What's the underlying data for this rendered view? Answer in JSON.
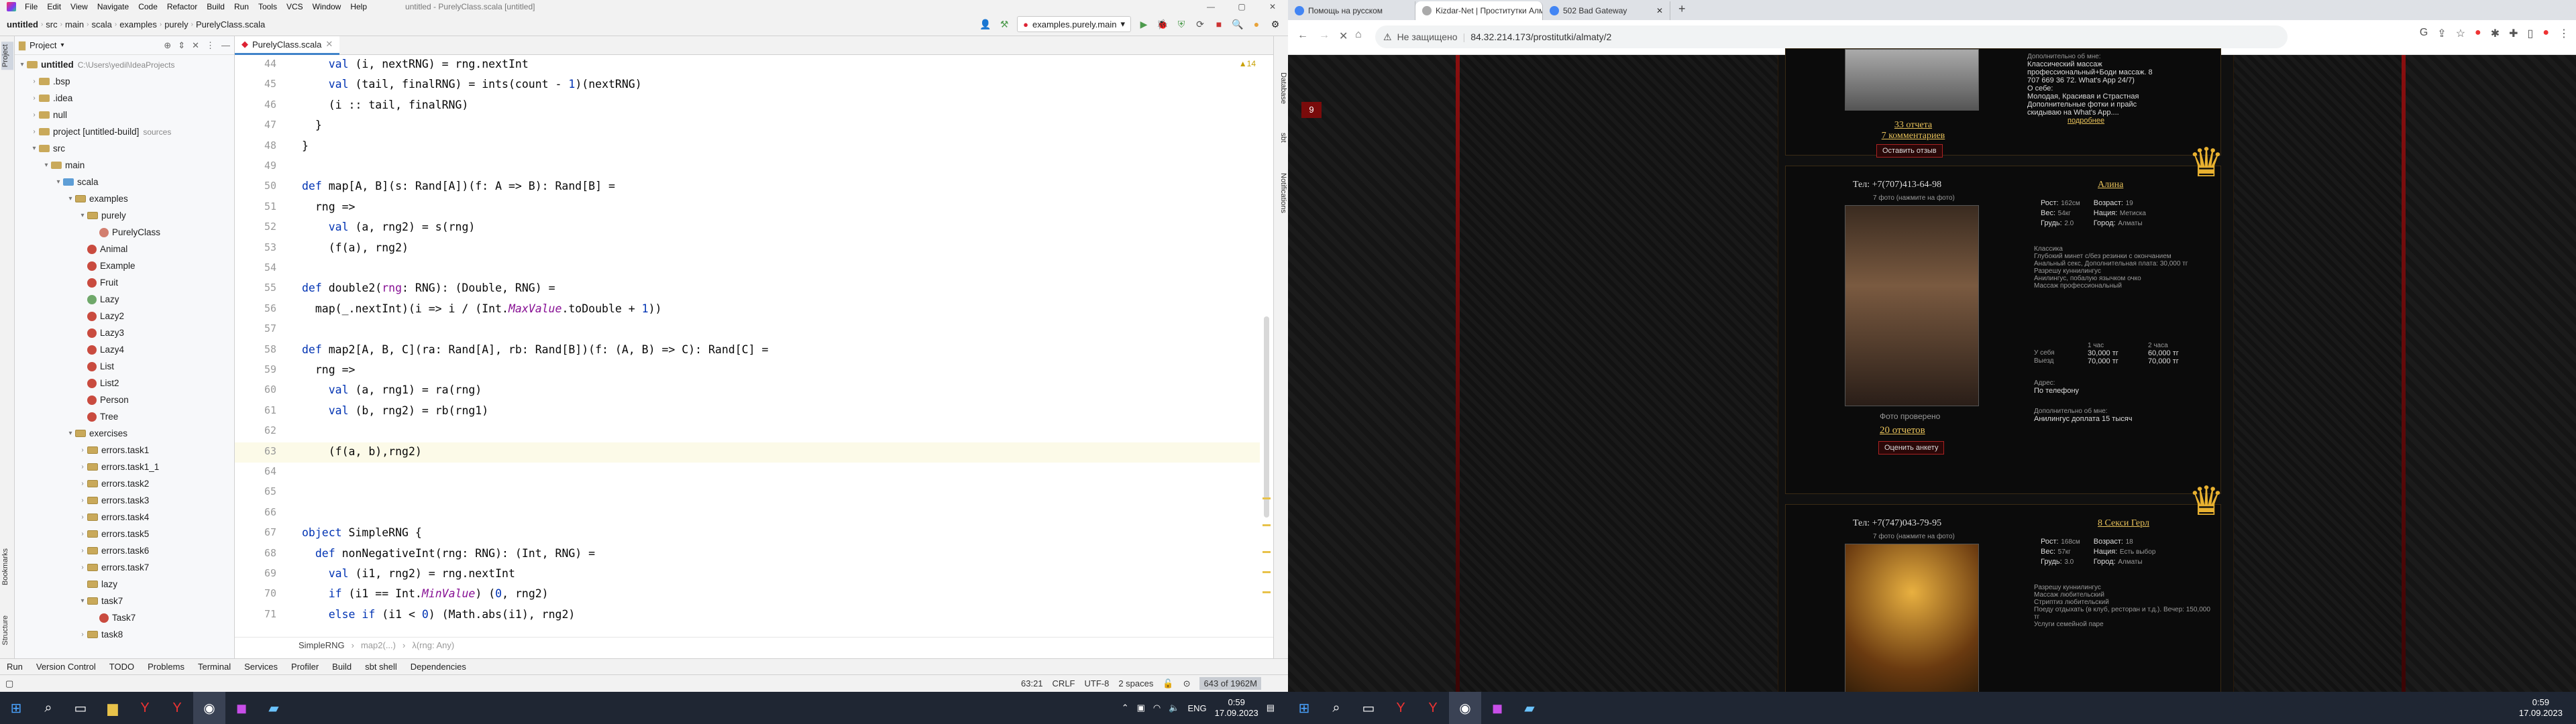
{
  "ide": {
    "menu": [
      "File",
      "Edit",
      "View",
      "Navigate",
      "Code",
      "Refactor",
      "Build",
      "Run",
      "Tools",
      "VCS",
      "Window",
      "Help"
    ],
    "window_title": "untitled - PurelyClass.scala [untitled]",
    "breadcrumbs": [
      "untitled",
      "src",
      "main",
      "scala",
      "examples",
      "purely",
      "PurelyClass.scala"
    ],
    "run_config": "examples.purely.main",
    "project_label": "Project",
    "tree": [
      {
        "indent": 0,
        "arrow": "▾",
        "icon": "f-folder",
        "label": "untitled",
        "extra": "C:\\Users\\yedil\\IdeaProjects",
        "bold": true
      },
      {
        "indent": 1,
        "arrow": "›",
        "icon": "f-folder",
        "label": ".bsp"
      },
      {
        "indent": 1,
        "arrow": "›",
        "icon": "f-folder",
        "label": ".idea"
      },
      {
        "indent": 1,
        "arrow": "›",
        "icon": "f-folder",
        "label": "null"
      },
      {
        "indent": 1,
        "arrow": "›",
        "icon": "f-folder",
        "label": "project [untitled-build]",
        "extra": "sources"
      },
      {
        "indent": 1,
        "arrow": "▾",
        "icon": "f-folder",
        "label": "src"
      },
      {
        "indent": 2,
        "arrow": "▾",
        "icon": "f-folder",
        "label": "main"
      },
      {
        "indent": 3,
        "arrow": "▾",
        "icon": "f-src",
        "label": "scala"
      },
      {
        "indent": 4,
        "arrow": "▾",
        "icon": "f-pkg",
        "label": "examples"
      },
      {
        "indent": 5,
        "arrow": "▾",
        "icon": "f-pkg",
        "label": "purely"
      },
      {
        "indent": 6,
        "arrow": "",
        "icon": "f-obj",
        "label": "PurelyClass"
      },
      {
        "indent": 5,
        "arrow": "",
        "icon": "f-class",
        "label": "Animal"
      },
      {
        "indent": 5,
        "arrow": "",
        "icon": "f-class",
        "label": "Example"
      },
      {
        "indent": 5,
        "arrow": "",
        "icon": "f-class",
        "label": "Fruit"
      },
      {
        "indent": 5,
        "arrow": "",
        "icon": "f-trait",
        "label": "Lazy"
      },
      {
        "indent": 5,
        "arrow": "",
        "icon": "f-class",
        "label": "Lazy2"
      },
      {
        "indent": 5,
        "arrow": "",
        "icon": "f-class",
        "label": "Lazy3"
      },
      {
        "indent": 5,
        "arrow": "",
        "icon": "f-class",
        "label": "Lazy4"
      },
      {
        "indent": 5,
        "arrow": "",
        "icon": "f-class",
        "label": "List"
      },
      {
        "indent": 5,
        "arrow": "",
        "icon": "f-class",
        "label": "List2"
      },
      {
        "indent": 5,
        "arrow": "",
        "icon": "f-class",
        "label": "Person"
      },
      {
        "indent": 5,
        "arrow": "",
        "icon": "f-class",
        "label": "Tree"
      },
      {
        "indent": 4,
        "arrow": "▾",
        "icon": "f-pkg",
        "label": "exercises"
      },
      {
        "indent": 5,
        "arrow": "›",
        "icon": "f-pkg",
        "label": "errors.task1"
      },
      {
        "indent": 5,
        "arrow": "›",
        "icon": "f-pkg",
        "label": "errors.task1_1"
      },
      {
        "indent": 5,
        "arrow": "›",
        "icon": "f-pkg",
        "label": "errors.task2"
      },
      {
        "indent": 5,
        "arrow": "›",
        "icon": "f-pkg",
        "label": "errors.task3"
      },
      {
        "indent": 5,
        "arrow": "›",
        "icon": "f-pkg",
        "label": "errors.task4"
      },
      {
        "indent": 5,
        "arrow": "›",
        "icon": "f-pkg",
        "label": "errors.task5"
      },
      {
        "indent": 5,
        "arrow": "›",
        "icon": "f-pkg",
        "label": "errors.task6"
      },
      {
        "indent": 5,
        "arrow": "›",
        "icon": "f-pkg",
        "label": "errors.task7"
      },
      {
        "indent": 5,
        "arrow": "",
        "icon": "f-pkg",
        "label": "lazy"
      },
      {
        "indent": 5,
        "arrow": "▾",
        "icon": "f-pkg",
        "label": "task7"
      },
      {
        "indent": 6,
        "arrow": "",
        "icon": "f-class",
        "label": "Task7"
      },
      {
        "indent": 5,
        "arrow": "›",
        "icon": "f-pkg",
        "label": "task8"
      }
    ],
    "editor_tab": "PurelyClass.scala",
    "warnings_count": "▲14",
    "code_lines": [
      {
        "n": "44",
        "html": "    <span class='kw'>val</span> (i, nextRNG) = rng.nextInt"
      },
      {
        "n": "45",
        "html": "    <span class='kw'>val</span> (tail, finalRNG) = ints(count - <span class='kw'>1</span>)(nextRNG)"
      },
      {
        "n": "46",
        "html": "    (i :: tail, finalRNG)"
      },
      {
        "n": "47",
        "html": "  }"
      },
      {
        "n": "48",
        "html": "}"
      },
      {
        "n": "49",
        "html": ""
      },
      {
        "n": "50",
        "html": "<span class='kw'>def</span> map[A, B](s: Rand[A])(f: A => B): Rand[B] ="
      },
      {
        "n": "51",
        "html": "  rng =>"
      },
      {
        "n": "52",
        "html": "    <span class='kw'>val</span> (a, rng2) = s(rng)"
      },
      {
        "n": "53",
        "html": "    (f(a), rng2)"
      },
      {
        "n": "54",
        "html": ""
      },
      {
        "n": "55",
        "html": "<span class='kw'>def</span> double2(<span class='pm'>rng</span>: RNG): (Double, RNG) ="
      },
      {
        "n": "56",
        "html": "  map(_.nextInt)(i => i / (Int.<span class='it'>MaxValue</span>.toDouble + <span class='kw'>1</span>))"
      },
      {
        "n": "57",
        "html": ""
      },
      {
        "n": "58",
        "html": "<span class='kw'>def</span> map2[A, B, C](ra: Rand[A], rb: Rand[B])(f: (A, B) => C): Rand[C] ="
      },
      {
        "n": "59",
        "html": "  rng =>"
      },
      {
        "n": "60",
        "html": "    <span class='kw'>val</span> (a, rng1) = ra(rng)"
      },
      {
        "n": "61",
        "html": "    <span class='kw'>val</span> (b, rng2) = rb(rng1)"
      },
      {
        "n": "62",
        "html": ""
      },
      {
        "n": "63",
        "html": "    (f(a, b),rng2)"
      },
      {
        "n": "64",
        "html": ""
      },
      {
        "n": "65",
        "html": ""
      },
      {
        "n": "66",
        "html": ""
      },
      {
        "n": "67",
        "html": "<span class='kw'>object</span> SimpleRNG {"
      },
      {
        "n": "68",
        "html": "  <span class='kw'>def</span> nonNegativeInt(rng: RNG): (Int, RNG) ="
      },
      {
        "n": "69",
        "html": "    <span class='kw'>val</span> (i1, rng2) = rng.nextInt"
      },
      {
        "n": "70",
        "html": "    <span class='kw'>if</span> (i1 == Int.<span class='it'>MinValue</span>) (<span class='kw'>0</span>, rng2)"
      },
      {
        "n": "71",
        "html": "    <span class='kw'>else if</span> (i1 < <span class='kw'>0</span>) (Math.abs(i1), rng2)"
      }
    ],
    "editor_breadcrumb": [
      "SimpleRNG",
      "map2(...)",
      "λ(rng: Any)"
    ],
    "tool_windows": [
      "Run",
      "Version Control",
      "TODO",
      "Problems",
      "Terminal",
      "Services",
      "Profiler",
      "Build",
      "sbt shell",
      "Dependencies"
    ],
    "right_tabs": [
      "Database",
      "sbt",
      "Notifications"
    ],
    "left_tabs": [
      "Project",
      "Bookmarks",
      "Structure"
    ],
    "status": {
      "position": "63:21",
      "line_sep": "CRLF",
      "encoding": "UTF-8",
      "indent": "2 spaces",
      "memory": "643 of 1962M"
    }
  },
  "taskbar": {
    "time": "0:59",
    "date": "17.09.2023",
    "lang": "ENG"
  },
  "browser": {
    "tabs": [
      {
        "title": "Помощь на русском",
        "color": "#4285f4"
      },
      {
        "title": "Kizdar-Net | Проститутки Алмат...",
        "color": "#888"
      },
      {
        "title": "502 Bad Gateway",
        "color": "#4285f4"
      }
    ],
    "not_secure": "Не защищено",
    "url": "84.32.214.173/prostitutki/almaty/2",
    "badge_number": "9",
    "card1": {
      "reports": "33 отчета",
      "comments": "7 комментариев",
      "leave_review": "Оставить отзыв",
      "extra_title": "Дополнительно об мне:",
      "extra_lines": [
        "Классический массаж",
        "профессиональный+Боди массаж. 8",
        "707 669 36 72. What's App 24/7)",
        "О себе:",
        "Молодая, Красивая и Страстная",
        "Дополнительные фотки и прайс",
        "скидываю на What's App....",
        "подробнее"
      ]
    },
    "card2": {
      "phone": "Тел: +7(707)413-64-98",
      "name": "Алина",
      "photo_hint": "7 фото (нажмите на фото)",
      "verified": "Фото проверено",
      "reports": "20 отчетов",
      "rate": "Оценить анкету",
      "params": [
        [
          "Рост:",
          "162см"
        ],
        [
          "Вес:",
          "54кг"
        ],
        [
          "Грудь:",
          "2.0"
        ]
      ],
      "params2": [
        [
          "Возраст:",
          "19"
        ],
        [
          "Нация:",
          "Метиска"
        ],
        [
          "Город:",
          "Алматы"
        ]
      ],
      "services": [
        "Классика",
        "Глубокий минет с/без резинки с окончанием",
        "Анальный секс, Дополнительная плата: 30,000 тг",
        "Разрешу куннилингус",
        "Анилингус, побалую язычком очко",
        "Массаж профессиональный"
      ],
      "price_head": [
        "",
        "1 час",
        "2 часа"
      ],
      "price_rows": [
        [
          "У себя",
          "30,000 тг",
          "60,000 тг"
        ],
        [
          "Выезд",
          "70,000 тг",
          "70,000 тг"
        ]
      ],
      "address_label": "Адрес:",
      "address": "По телефону",
      "extra_title": "Дополнительно об мне:",
      "extra": "Анилингус доплата 15 тысяч"
    },
    "card3": {
      "phone": "Тел: +7(747)043-79-95",
      "name": "8 Секси Герл",
      "photo_hint": "7 фото (нажмите на фото)",
      "params": [
        [
          "Рост:",
          "168см"
        ],
        [
          "Вес:",
          "57кг"
        ],
        [
          "Грудь:",
          "3.0"
        ]
      ],
      "params2": [
        [
          "Возраст:",
          "18"
        ],
        [
          "Нация:",
          "Есть выбор"
        ],
        [
          "Город:",
          "Алматы"
        ]
      ],
      "services": [
        "Разрешу куннилингус",
        "Массаж любительский",
        "Стриптиз любительский",
        "Поеду отдыхать (в клуб, ресторан и т.д.). Вечер: 150,000 тг",
        "Услуги семейной паре"
      ]
    }
  },
  "btaskbar": {
    "time": "0:59",
    "date": "17.09.2023"
  }
}
